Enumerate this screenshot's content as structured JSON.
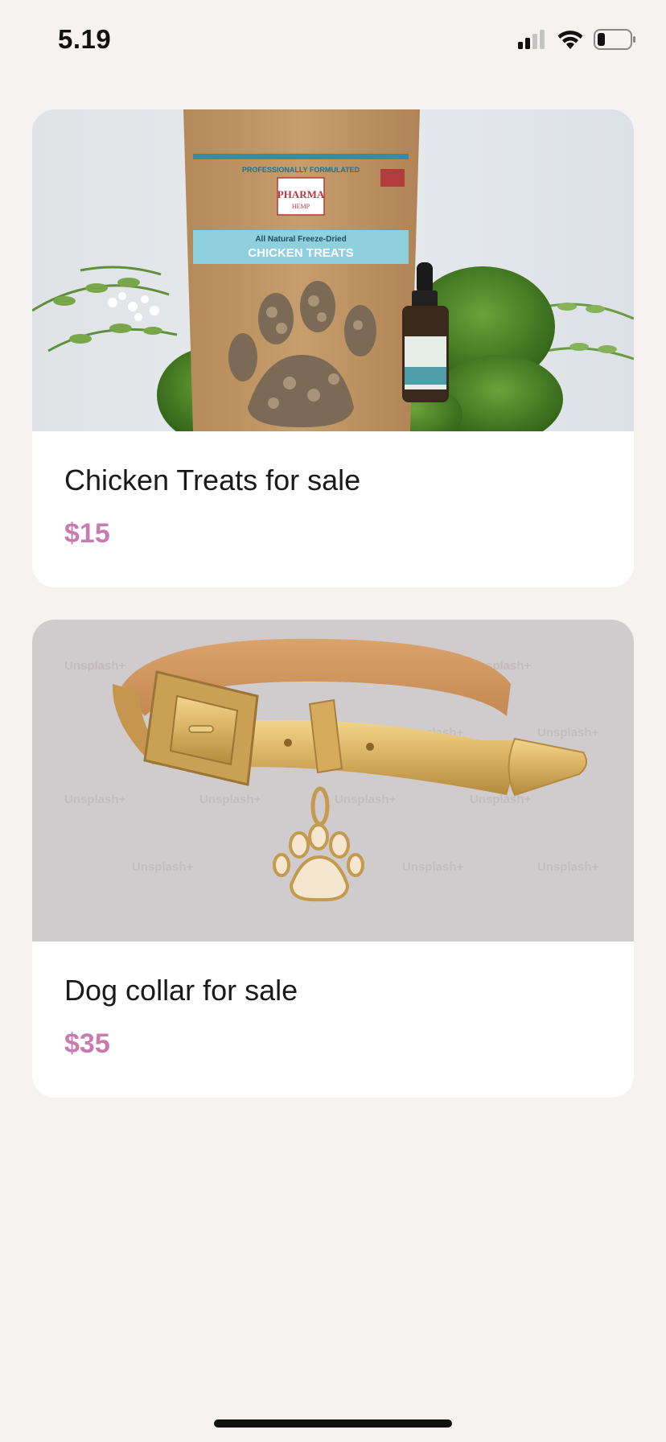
{
  "status_bar": {
    "time": "5.19",
    "icons": [
      "cellular-signal-icon",
      "wifi-icon",
      "battery-icon"
    ]
  },
  "products": [
    {
      "title": "Chicken Treats for sale",
      "price": "$15",
      "image": "chicken-treats-product-image",
      "image_text": {
        "tagline": "PROFESSIONALLY FORMULATED",
        "brand": "PHARMA",
        "brand_sub": "HEMP",
        "sub_heading": "All Natural Freeze-Dried",
        "heading": "CHICKEN TREATS"
      }
    },
    {
      "title": "Dog collar for sale",
      "price": "$35",
      "image": "dog-collar-product-image",
      "watermark": "Unsplash+"
    }
  ],
  "colors": {
    "background": "#f5f2f1",
    "card": "#ffffff",
    "price": "#c97bb1",
    "title": "#1a1a1a"
  }
}
